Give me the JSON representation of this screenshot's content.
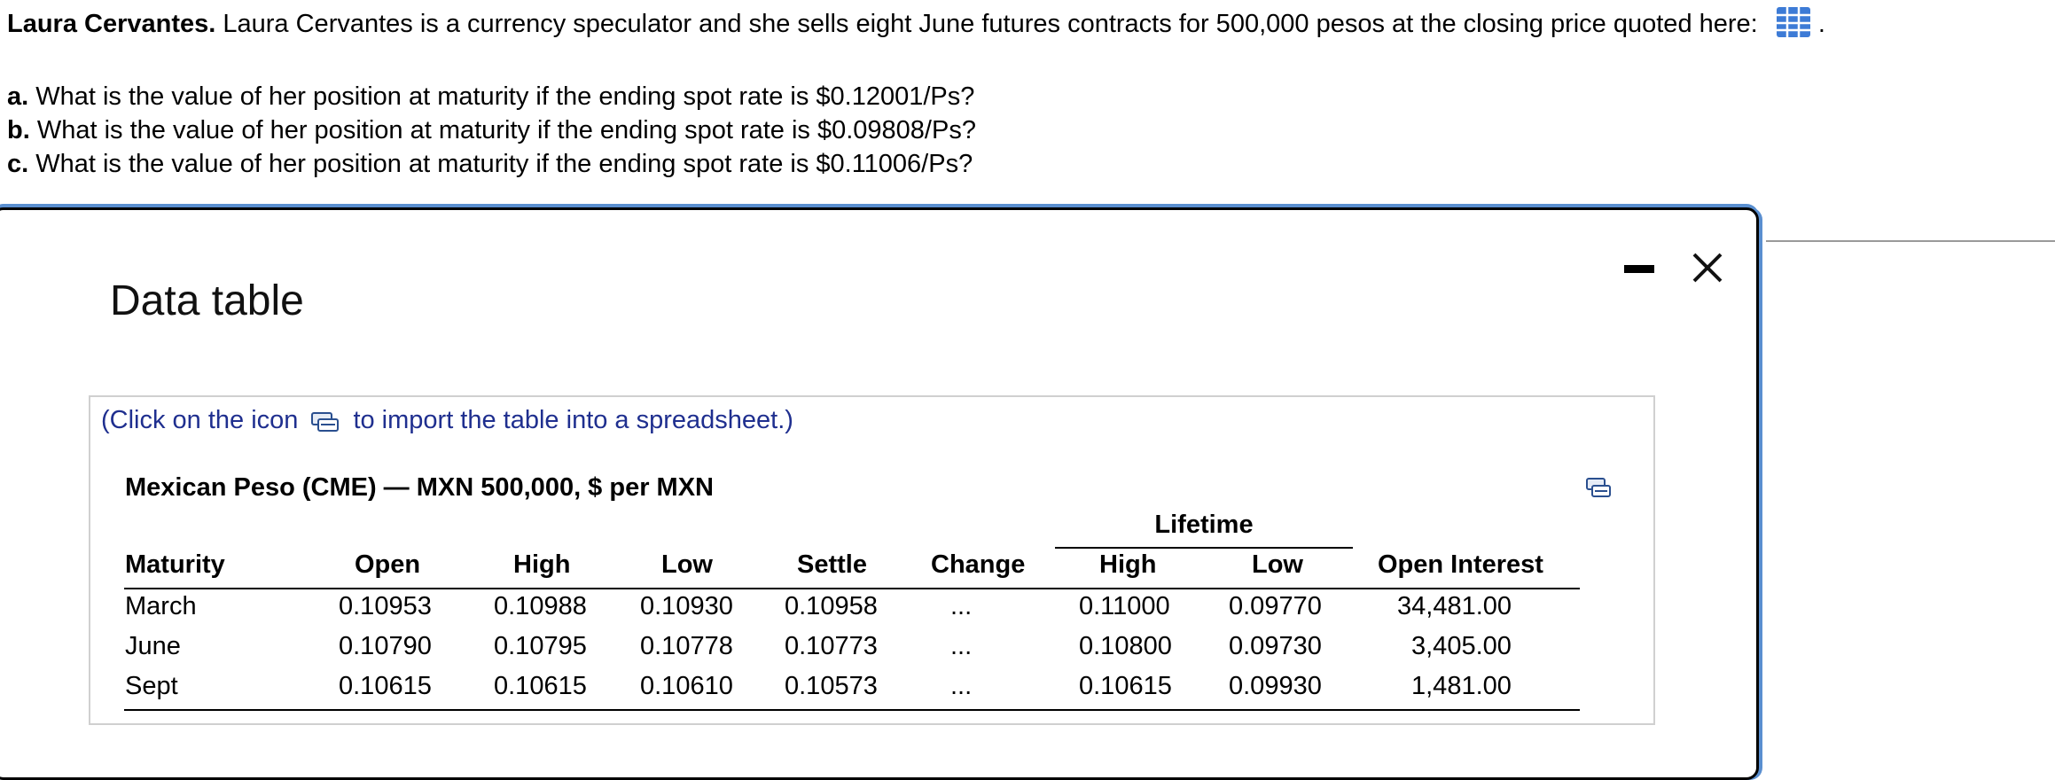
{
  "problem": {
    "name": "Laura Cervantes.",
    "text": "Laura Cervantes is a currency speculator and she sells eight June futures contracts for 500,000 pesos at the closing price quoted here:",
    "trailing": "."
  },
  "questions": [
    {
      "label": "a.",
      "text": "What is the value of her position at maturity if the ending spot rate is $0.12001/Ps?"
    },
    {
      "label": "b.",
      "text": "What is the value of her position at maturity if the ending spot rate is $0.09808/Ps?"
    },
    {
      "label": "c.",
      "text": "What is the value of her position at maturity if the ending spot rate is $0.11006/Ps?"
    }
  ],
  "dialog": {
    "title": "Data table",
    "import_note_before": "(Click on the icon",
    "import_note_after": "to import the table into a spreadsheet.)"
  },
  "table": {
    "title": "Mexican Peso (CME) — MXN 500,000, $ per MXN",
    "group_header": "Lifetime",
    "columns": [
      "Maturity",
      "Open",
      "High",
      "Low",
      "Settle",
      "Change",
      "High",
      "Low",
      "Open Interest"
    ],
    "rows": [
      [
        "March",
        "0.10953",
        "0.10988",
        "0.10930",
        "0.10958",
        "...",
        "0.11000",
        "0.09770",
        "34,481.00"
      ],
      [
        "June",
        "0.10790",
        "0.10795",
        "0.10778",
        "0.10773",
        "...",
        "0.10800",
        "0.09730",
        "3,405.00"
      ],
      [
        "Sept",
        "0.10615",
        "0.10615",
        "0.10610",
        "0.10573",
        "...",
        "0.10615",
        "0.09930",
        "1,481.00"
      ]
    ]
  },
  "colors": {
    "accent": "#5a8fd0",
    "link_text": "#1f2f8f",
    "grid_icon": "#3d7bd6"
  },
  "icons": {
    "data_table": "table-grid-icon",
    "import": "spreadsheet-import-icon",
    "minimize": "minimize-icon",
    "close": "close-icon"
  }
}
